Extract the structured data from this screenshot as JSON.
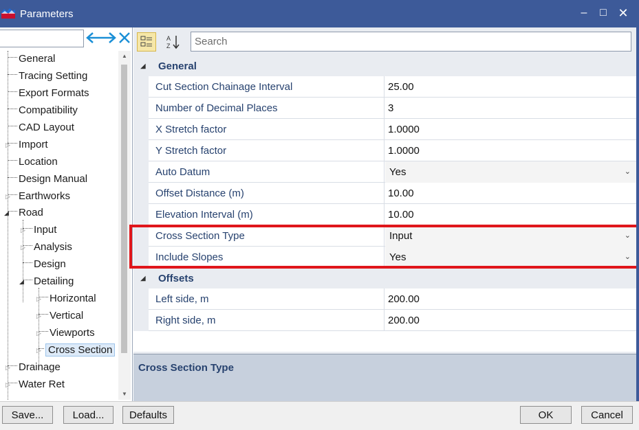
{
  "window": {
    "title": "Parameters",
    "minimize_glyph": "‒",
    "maximize_glyph": "□",
    "close_glyph": "✕"
  },
  "tree": {
    "search_value": "",
    "items": [
      {
        "label": "General"
      },
      {
        "label": "Tracing Setting"
      },
      {
        "label": "Export Formats"
      },
      {
        "label": "Compatibility"
      },
      {
        "label": "CAD Layout"
      },
      {
        "label": "Import"
      },
      {
        "label": "Location"
      },
      {
        "label": "Design Manual"
      },
      {
        "label": "Earthworks"
      },
      {
        "label": "Road"
      },
      {
        "label": "Input"
      },
      {
        "label": "Analysis"
      },
      {
        "label": "Design"
      },
      {
        "label": "Detailing"
      },
      {
        "label": "Horizontal"
      },
      {
        "label": "Vertical"
      },
      {
        "label": "Viewports"
      },
      {
        "label": "Cross Section"
      },
      {
        "label": "Drainage"
      },
      {
        "label": "Water Ret"
      }
    ]
  },
  "toolbar": {
    "search_placeholder": "Search"
  },
  "grid": {
    "categories": [
      {
        "label": "General",
        "properties": [
          {
            "name": "Cut Section Chainage Interval",
            "value": "25.00"
          },
          {
            "name": "Number of Decimal Places",
            "value": "3"
          },
          {
            "name": "X Stretch factor",
            "value": "1.0000"
          },
          {
            "name": "Y Stretch factor",
            "value": "1.0000"
          },
          {
            "name": "Auto Datum",
            "value": "Yes"
          },
          {
            "name": "Offset Distance (m)",
            "value": "10.00"
          },
          {
            "name": "Elevation Interval (m)",
            "value": "10.00"
          },
          {
            "name": "Cross Section Type",
            "value": "Input"
          },
          {
            "name": "Include Slopes",
            "value": "Yes"
          }
        ]
      },
      {
        "label": "Offsets",
        "properties": [
          {
            "name": "Left side, m",
            "value": "200.00"
          },
          {
            "name": "Right side, m",
            "value": "200.00"
          }
        ]
      }
    ]
  },
  "description": {
    "title": "Cross Section Type"
  },
  "buttons": {
    "save": "Save...",
    "load": "Load...",
    "defaults": "Defaults",
    "ok": "OK",
    "cancel": "Cancel"
  },
  "colors": {
    "titlebar": "#3d5a99",
    "highlight": "#e0161b",
    "property_text": "#27426f"
  }
}
